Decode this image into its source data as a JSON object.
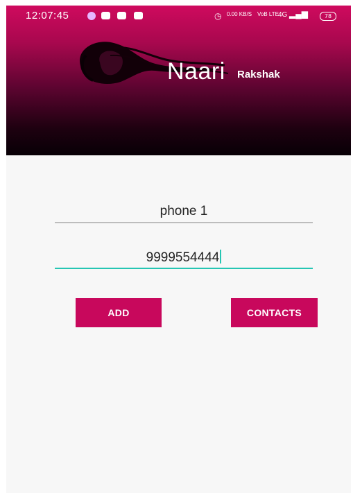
{
  "status_bar": {
    "time": "12:07:45",
    "speed": "0.00 KB/S",
    "network": "VoB LTE",
    "signal": "4G",
    "battery": "78"
  },
  "brand": {
    "name_primary": "Naari",
    "name_secondary": "Rakshak"
  },
  "form": {
    "name_field": {
      "value": "phone 1"
    },
    "phone_field": {
      "value": "9999554444"
    }
  },
  "buttons": {
    "add_label": "ADD",
    "contacts_label": "CONTACTS"
  },
  "colors": {
    "accent": "#c8085c",
    "header_top": "#cf0a5e",
    "header_bottom": "#080006",
    "focus_underline": "#26c6b3"
  }
}
